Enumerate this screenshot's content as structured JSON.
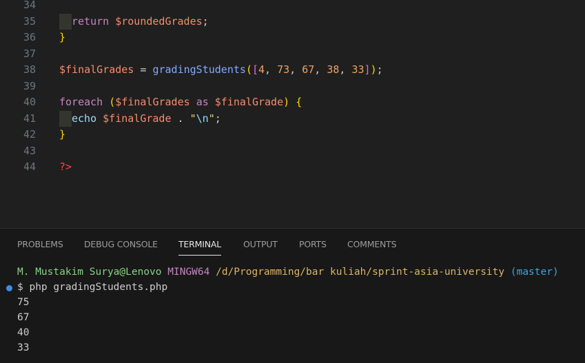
{
  "editor": {
    "lines": [
      {
        "number": "34",
        "tokens": []
      },
      {
        "number": "35",
        "guide": true,
        "tokens": [
          {
            "cls": "tok-keyword",
            "text": "return"
          },
          {
            "cls": "tok-punct",
            "text": " "
          },
          {
            "cls": "tok-var",
            "text": "$roundedGrades"
          },
          {
            "cls": "tok-punct",
            "text": ";"
          }
        ]
      },
      {
        "number": "36",
        "tokens": [
          {
            "cls": "tok-bracket-1",
            "text": "}"
          }
        ]
      },
      {
        "number": "37",
        "tokens": []
      },
      {
        "number": "38",
        "tokens": [
          {
            "cls": "tok-var",
            "text": "$finalGrades"
          },
          {
            "cls": "tok-punct",
            "text": " "
          },
          {
            "cls": "tok-op",
            "text": "="
          },
          {
            "cls": "tok-punct",
            "text": " "
          },
          {
            "cls": "tok-func",
            "text": "gradingStudents"
          },
          {
            "cls": "tok-bracket-1",
            "text": "("
          },
          {
            "cls": "tok-bracket-2",
            "text": "["
          },
          {
            "cls": "tok-num",
            "text": "4"
          },
          {
            "cls": "tok-punct",
            "text": ", "
          },
          {
            "cls": "tok-num",
            "text": "73"
          },
          {
            "cls": "tok-punct",
            "text": ", "
          },
          {
            "cls": "tok-num",
            "text": "67"
          },
          {
            "cls": "tok-punct",
            "text": ", "
          },
          {
            "cls": "tok-num",
            "text": "38"
          },
          {
            "cls": "tok-punct",
            "text": ", "
          },
          {
            "cls": "tok-num",
            "text": "33"
          },
          {
            "cls": "tok-bracket-2",
            "text": "]"
          },
          {
            "cls": "tok-bracket-1",
            "text": ")"
          },
          {
            "cls": "tok-punct",
            "text": ";"
          }
        ]
      },
      {
        "number": "39",
        "tokens": []
      },
      {
        "number": "40",
        "tokens": [
          {
            "cls": "tok-keyword-flow",
            "text": "foreach"
          },
          {
            "cls": "tok-punct",
            "text": " "
          },
          {
            "cls": "tok-bracket-1",
            "text": "("
          },
          {
            "cls": "tok-var",
            "text": "$finalGrades"
          },
          {
            "cls": "tok-punct",
            "text": " "
          },
          {
            "cls": "tok-keyword",
            "text": "as"
          },
          {
            "cls": "tok-punct",
            "text": " "
          },
          {
            "cls": "tok-var",
            "text": "$finalGrade"
          },
          {
            "cls": "tok-bracket-1",
            "text": ")"
          },
          {
            "cls": "tok-punct",
            "text": " "
          },
          {
            "cls": "tok-bracket-1",
            "text": "{"
          }
        ]
      },
      {
        "number": "41",
        "guide": true,
        "tokens": [
          {
            "cls": "tok-plain",
            "text": "echo"
          },
          {
            "cls": "tok-punct",
            "text": " "
          },
          {
            "cls": "tok-var",
            "text": "$finalGrade"
          },
          {
            "cls": "tok-punct",
            "text": " "
          },
          {
            "cls": "tok-op",
            "text": "."
          },
          {
            "cls": "tok-punct",
            "text": " "
          },
          {
            "cls": "tok-str",
            "text": "\""
          },
          {
            "cls": "tok-escape",
            "text": "\\n"
          },
          {
            "cls": "tok-str",
            "text": "\""
          },
          {
            "cls": "tok-punct",
            "text": ";"
          }
        ]
      },
      {
        "number": "42",
        "tokens": [
          {
            "cls": "tok-bracket-1",
            "text": "}"
          }
        ]
      },
      {
        "number": "43",
        "tokens": []
      },
      {
        "number": "44",
        "tokens": [
          {
            "cls": "tok-php",
            "text": "?>"
          }
        ]
      }
    ]
  },
  "panel": {
    "tabs": [
      {
        "label": "PROBLEMS",
        "active": false
      },
      {
        "label": "DEBUG CONSOLE",
        "active": false
      },
      {
        "label": "TERMINAL",
        "active": true
      },
      {
        "label": "OUTPUT",
        "active": false
      },
      {
        "label": "PORTS",
        "active": false
      },
      {
        "label": "COMMENTS",
        "active": false
      }
    ]
  },
  "terminal": {
    "prompt_user": "M. Mustakim Surya@Lenovo",
    "prompt_host": "MINGW64",
    "prompt_path": "/d/Programming/bar kuliah/sprint-asia-university",
    "prompt_branch": "(master)",
    "command": "$ php gradingStudents.php",
    "output": [
      "75",
      "67",
      "40",
      "33"
    ]
  },
  "colors": {
    "background": "#1f1f1f",
    "panel_background": "#181818",
    "command_dot": "#3b8eea"
  }
}
